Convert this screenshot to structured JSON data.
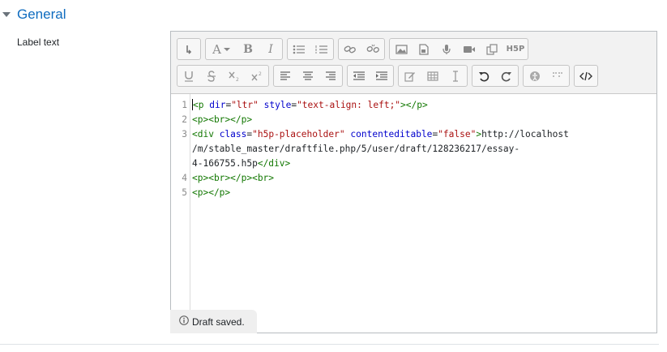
{
  "section": {
    "title": "General",
    "toggle_icon": "caret-down-icon"
  },
  "field": {
    "label": "Label text"
  },
  "toolbar": {
    "font_label": "A",
    "bold": "B",
    "italic": "I",
    "h5p_label": "H5P",
    "icons": [
      "collapse-icon",
      "font-icon",
      "bold-icon",
      "italic-icon",
      "unordered-list-icon",
      "ordered-list-icon",
      "link-icon",
      "unlink-icon",
      "image-icon",
      "media-file-icon",
      "record-audio-icon",
      "record-video-icon",
      "manage-files-icon",
      "h5p-icon",
      "underline-icon",
      "strikethrough-icon",
      "subscript-icon",
      "superscript-icon",
      "align-left-icon",
      "align-center-icon",
      "align-right-icon",
      "outdent-icon",
      "indent-icon",
      "equation-icon",
      "table-icon",
      "clear-format-icon",
      "undo-icon",
      "redo-icon",
      "accessibility-checker-icon",
      "screenreader-helper-icon",
      "html-source-icon"
    ]
  },
  "code": {
    "lines": [
      {
        "num": "1",
        "tokens": [
          {
            "c": "t",
            "v": "<p "
          },
          {
            "c": "a",
            "v": "dir"
          },
          {
            "c": "",
            "v": "="
          },
          {
            "c": "s",
            "v": "\"ltr\""
          },
          {
            "c": "",
            "v": " "
          },
          {
            "c": "a",
            "v": "style"
          },
          {
            "c": "",
            "v": "="
          },
          {
            "c": "s",
            "v": "\"text-align: left;\""
          },
          {
            "c": "t",
            "v": "></p>"
          }
        ]
      },
      {
        "num": "2",
        "tokens": [
          {
            "c": "t",
            "v": "<p><br></p>"
          }
        ]
      },
      {
        "num": "3",
        "tokens": [
          {
            "c": "t",
            "v": "<div "
          },
          {
            "c": "a",
            "v": "class"
          },
          {
            "c": "",
            "v": "="
          },
          {
            "c": "s",
            "v": "\"h5p-placeholder\""
          },
          {
            "c": "",
            "v": " "
          },
          {
            "c": "a",
            "v": "contenteditable"
          },
          {
            "c": "",
            "v": "="
          },
          {
            "c": "s",
            "v": "\"false\""
          },
          {
            "c": "t",
            "v": ">"
          },
          {
            "c": "",
            "v": "http://localhost"
          }
        ]
      },
      {
        "num": "",
        "tokens": [
          {
            "c": "",
            "v": "/m/stable_master/draftfile.php/5/user/draft/128236217/essay-"
          }
        ]
      },
      {
        "num": "",
        "tokens": [
          {
            "c": "",
            "v": "4-166755.h5p"
          },
          {
            "c": "t",
            "v": "</div>"
          }
        ]
      },
      {
        "num": "4",
        "tokens": [
          {
            "c": "t",
            "v": "<p><br></p><br>"
          }
        ]
      },
      {
        "num": "5",
        "tokens": [
          {
            "c": "t",
            "v": "<p></p>"
          }
        ]
      }
    ]
  },
  "status": {
    "text": "Draft saved.",
    "icon": "info-icon"
  }
}
